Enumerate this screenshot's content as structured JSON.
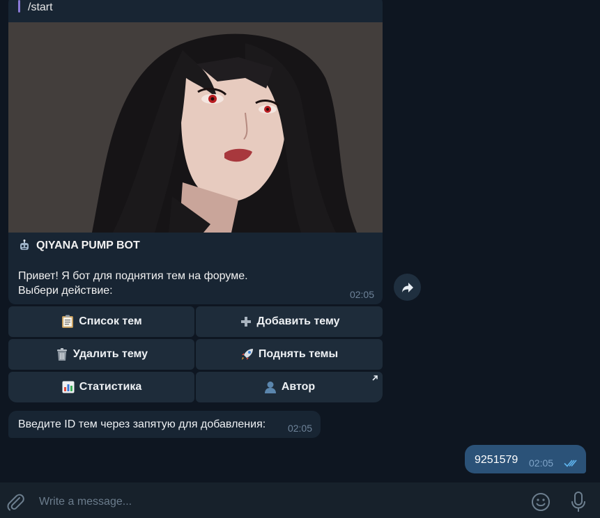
{
  "reply_quote": "/start",
  "bot_message": {
    "title": "QIYANA PUMP BOT",
    "line1": "Привет! Я бот для поднятия тем на форуме.",
    "line2": "Выбери действие:",
    "time": "02:05"
  },
  "keyboard": [
    {
      "label": "Список тем",
      "icon": "clipboard-icon"
    },
    {
      "label": "Добавить тему",
      "icon": "plus-icon"
    },
    {
      "label": "Удалить тему",
      "icon": "trash-icon"
    },
    {
      "label": "Поднять темы",
      "icon": "rocket-icon"
    },
    {
      "label": "Статистика",
      "icon": "bar-chart-icon"
    },
    {
      "label": "Автор",
      "icon": "user-icon"
    }
  ],
  "bot_message2": {
    "text": "Введите ID тем через запятую для добавления:",
    "time": "02:05"
  },
  "outgoing_message": {
    "text": "9251579",
    "time": "02:05"
  },
  "composer": {
    "placeholder": "Write a message..."
  },
  "colors": {
    "background": "#0e1621",
    "bubble_in": "#182533",
    "bubble_out": "#2b5278",
    "button": "#1e2c3a",
    "accent_reply": "#8a7ad6"
  }
}
